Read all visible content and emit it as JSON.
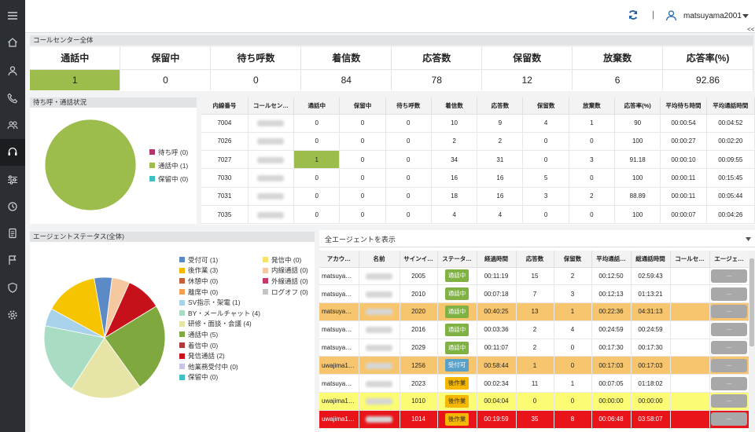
{
  "topbar": {
    "separator": "|",
    "username": "matsuyama2001",
    "collapse": "<<"
  },
  "sidebar": {
    "icons": [
      "menu-icon",
      "home-icon",
      "user-icon",
      "phone-icon",
      "group-icon",
      "headset-icon",
      "sliders-icon",
      "history-icon",
      "document-icon",
      "flag-icon",
      "shield-icon",
      "gear-icon"
    ],
    "active_index": 5
  },
  "call_center": {
    "title": "コールセンター全体",
    "headers": [
      "通話中",
      "保留中",
      "待ち呼数",
      "着信数",
      "応答数",
      "保留数",
      "放棄数",
      "応答率(%)"
    ],
    "values": [
      "1",
      "0",
      "0",
      "84",
      "78",
      "12",
      "6",
      "92.86"
    ],
    "highlight_color": "#9cbc4c"
  },
  "wait_status": {
    "title": "待ち呼・通話状況",
    "legend": [
      {
        "label": "待ち呼 (0)",
        "color": "#b5346b"
      },
      {
        "label": "通話中 (1)",
        "color": "#9cbc4c"
      },
      {
        "label": "保留中 (0)",
        "color": "#3ec0c4"
      }
    ],
    "pie_values": [
      0,
      1,
      0
    ]
  },
  "extension_table": {
    "headers": [
      "内線番号",
      "コールセン…",
      "通話中",
      "保留中",
      "待ち呼数",
      "着信数",
      "応答数",
      "保留数",
      "放棄数",
      "応答率(%)",
      "平均待ち時間",
      "平均通話時間"
    ],
    "rows": [
      [
        "7004",
        "",
        "0",
        "0",
        "0",
        "10",
        "9",
        "4",
        "1",
        "90",
        "00:00:54",
        "00:04:52"
      ],
      [
        "7026",
        "",
        "0",
        "0",
        "0",
        "2",
        "2",
        "0",
        "0",
        "100",
        "00:00:27",
        "00:02:20"
      ],
      [
        "7027",
        "",
        "1",
        "0",
        "0",
        "34",
        "31",
        "0",
        "3",
        "91.18",
        "00:00:10",
        "00:09:55"
      ],
      [
        "7030",
        "",
        "0",
        "0",
        "0",
        "16",
        "16",
        "5",
        "0",
        "100",
        "00:00:11",
        "00:15:45"
      ],
      [
        "7031",
        "",
        "0",
        "0",
        "0",
        "18",
        "16",
        "3",
        "2",
        "88.89",
        "00:00:11",
        "00:05:44"
      ],
      [
        "7035",
        "",
        "0",
        "0",
        "0",
        "4",
        "4",
        "0",
        "0",
        "100",
        "00:00:07",
        "00:04:26"
      ]
    ]
  },
  "agent_status": {
    "title": "エージェントステータス(全体)",
    "legend_left": [
      {
        "label": "受付可 (1)",
        "color": "#5b8ac6"
      },
      {
        "label": "後作業 (3)",
        "color": "#f6b900"
      },
      {
        "label": "休憩中 (0)",
        "color": "#c95f3a"
      },
      {
        "label": "離席中 (0)",
        "color": "#f4a050"
      },
      {
        "label": "SV指示・架電 (1)",
        "color": "#a7d2ea"
      },
      {
        "label": "BY・メールチャット (4)",
        "color": "#a8ddc4"
      },
      {
        "label": "研修・面談・会議 (4)",
        "color": "#e6e4a6"
      },
      {
        "label": "通話中 (5)",
        "color": "#7fa83e"
      },
      {
        "label": "着信中 (0)",
        "color": "#b23a3a"
      },
      {
        "label": "発信通話 (2)",
        "color": "#c6101a"
      },
      {
        "label": "他業務受付中 (0)",
        "color": "#c9c4e6"
      },
      {
        "label": "保留中 (0)",
        "color": "#3ec0c4"
      }
    ],
    "legend_right": [
      {
        "label": "発信中 (0)",
        "color": "#f7e36a"
      },
      {
        "label": "内線通話 (0)",
        "color": "#f4c8a2"
      },
      {
        "label": "外線通話 (0)",
        "color": "#c8386a"
      },
      {
        "label": "ログオフ (0)",
        "color": "#c4c4c4"
      }
    ],
    "pie_slices": [
      {
        "value": 1,
        "color": "#5b8ac6"
      },
      {
        "value": 1,
        "color": "#f5c8a0"
      },
      {
        "value": 2,
        "color": "#c6101a"
      },
      {
        "value": 5,
        "color": "#7fa83e"
      },
      {
        "value": 4,
        "color": "#e6e4a6"
      },
      {
        "value": 4,
        "color": "#a8ddc4"
      },
      {
        "value": 1,
        "color": "#a7d2ea"
      },
      {
        "value": 3,
        "color": "#f6c400"
      }
    ]
  },
  "agents": {
    "filter_label": "全エージェントを表示",
    "headers": [
      "アカウ…",
      "名前",
      "サインイ…",
      "ステータ…",
      "経過時間",
      "応答数",
      "保留数",
      "平均通話…",
      "総通話時間",
      "コールセ…",
      "エージェ…"
    ],
    "action_label": "...",
    "rows": [
      {
        "account": "matsuya…",
        "signin": "2005",
        "status": "通話中",
        "status_color": "green",
        "elapsed": "00:11:19",
        "answered": "15",
        "hold": "2",
        "avg": "00:12:50",
        "total": "02:59:43",
        "row": ""
      },
      {
        "account": "matsuya…",
        "signin": "2010",
        "status": "通話中",
        "status_color": "green",
        "elapsed": "00:07:18",
        "answered": "7",
        "hold": "3",
        "avg": "00:12:13",
        "total": "01:13:21",
        "row": ""
      },
      {
        "account": "matsuya…",
        "signin": "2020",
        "status": "通話中",
        "status_color": "green",
        "elapsed": "00:40:25",
        "answered": "13",
        "hold": "1",
        "avg": "00:22:36",
        "total": "04:31:13",
        "row": "orange"
      },
      {
        "account": "matsuya…",
        "signin": "2016",
        "status": "通話中",
        "status_color": "green",
        "elapsed": "00:03:36",
        "answered": "2",
        "hold": "4",
        "avg": "00:24:59",
        "total": "00:24:59",
        "row": ""
      },
      {
        "account": "matsuya…",
        "signin": "2029",
        "status": "通話中",
        "status_color": "green",
        "elapsed": "00:11:07",
        "answered": "2",
        "hold": "0",
        "avg": "00:17:30",
        "total": "00:17:30",
        "row": ""
      },
      {
        "account": "uwajima1…",
        "signin": "1256",
        "status": "受付可",
        "status_color": "blue",
        "elapsed": "00:58:44",
        "answered": "1",
        "hold": "0",
        "avg": "00:17:03",
        "total": "00:17:03",
        "row": "orange"
      },
      {
        "account": "matsuya…",
        "signin": "2023",
        "status": "後作業",
        "status_color": "yellow",
        "elapsed": "00:02:34",
        "answered": "11",
        "hold": "1",
        "avg": "00:07:05",
        "total": "01:18:02",
        "row": ""
      },
      {
        "account": "uwajima1…",
        "signin": "1010",
        "status": "後作業",
        "status_color": "yellow",
        "elapsed": "00:04:04",
        "answered": "0",
        "hold": "0",
        "avg": "00:00:00",
        "total": "00:00:00",
        "row": "yellow"
      },
      {
        "account": "uwajima1…",
        "signin": "1014",
        "status": "後作業",
        "status_color": "yellow",
        "elapsed": "00:19:59",
        "answered": "35",
        "hold": "8",
        "avg": "00:06:48",
        "total": "03:58:07",
        "row": "red"
      }
    ]
  }
}
